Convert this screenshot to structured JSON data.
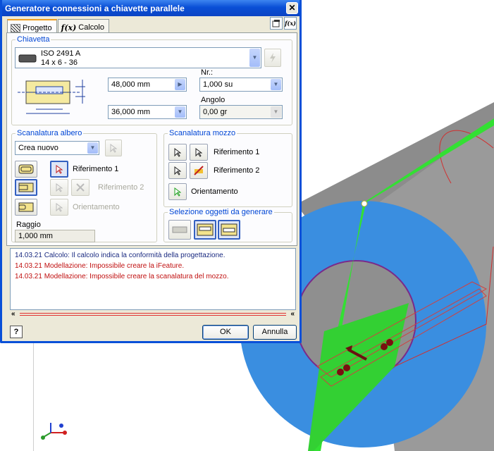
{
  "dialog": {
    "title": "Generatore connessioni a chiavette parallele",
    "close_glyph": "✕"
  },
  "tabs": [
    {
      "label": "Progetto",
      "icon": "hatch-icon"
    },
    {
      "label": "Calcolo",
      "icon": "fx-icon"
    }
  ],
  "fx_glyph": "f(x)",
  "chiavetta": {
    "title": "Chiavetta",
    "standard": "ISO 2491 A",
    "size": "14 x 6 - 36"
  },
  "dimensions": {
    "length1": "48,000 mm",
    "length2": "36,000 mm"
  },
  "count": {
    "label": "Nr.:",
    "value": "1,000 su"
  },
  "angle": {
    "label": "Angolo",
    "value": "0,00 gr"
  },
  "shaft_groove": {
    "title": "Scanalatura albero",
    "mode": "Crea nuovo",
    "ref1": "Riferimento 1",
    "ref2": "Riferimento 2",
    "orient": "Orientamento",
    "radius_label": "Raggio",
    "radius_value": "1,000 mm"
  },
  "hub_groove": {
    "title": "Scanalatura mozzo",
    "ref1": "Riferimento 1",
    "ref2": "Riferimento 2",
    "orient": "Orientamento"
  },
  "generate": {
    "title": "Selezione oggetti da generare"
  },
  "messages": [
    {
      "text": "14.03.21 Calcolo: Il calcolo indica la conformità della progettazione.",
      "kind": "ok"
    },
    {
      "text": "14.03.21 Modellazione: Impossibile creare la iFeature.",
      "kind": "err"
    },
    {
      "text": "14.03.21 Modellazione: Impossibile creare la scanalatura del mozzo.",
      "kind": "err"
    }
  ],
  "buttons": {
    "help": "?",
    "ok": "OK",
    "cancel": "Annulla",
    "collapse": "«"
  },
  "colors": {
    "title_bar": "#0a4fd6",
    "group_title": "#0046d5",
    "error": "#c01010",
    "info": "#1a2a80",
    "cylinder_gray": "#8c8c8c",
    "hub_blue": "#3a8ee0",
    "plane_green": "#33e033"
  }
}
